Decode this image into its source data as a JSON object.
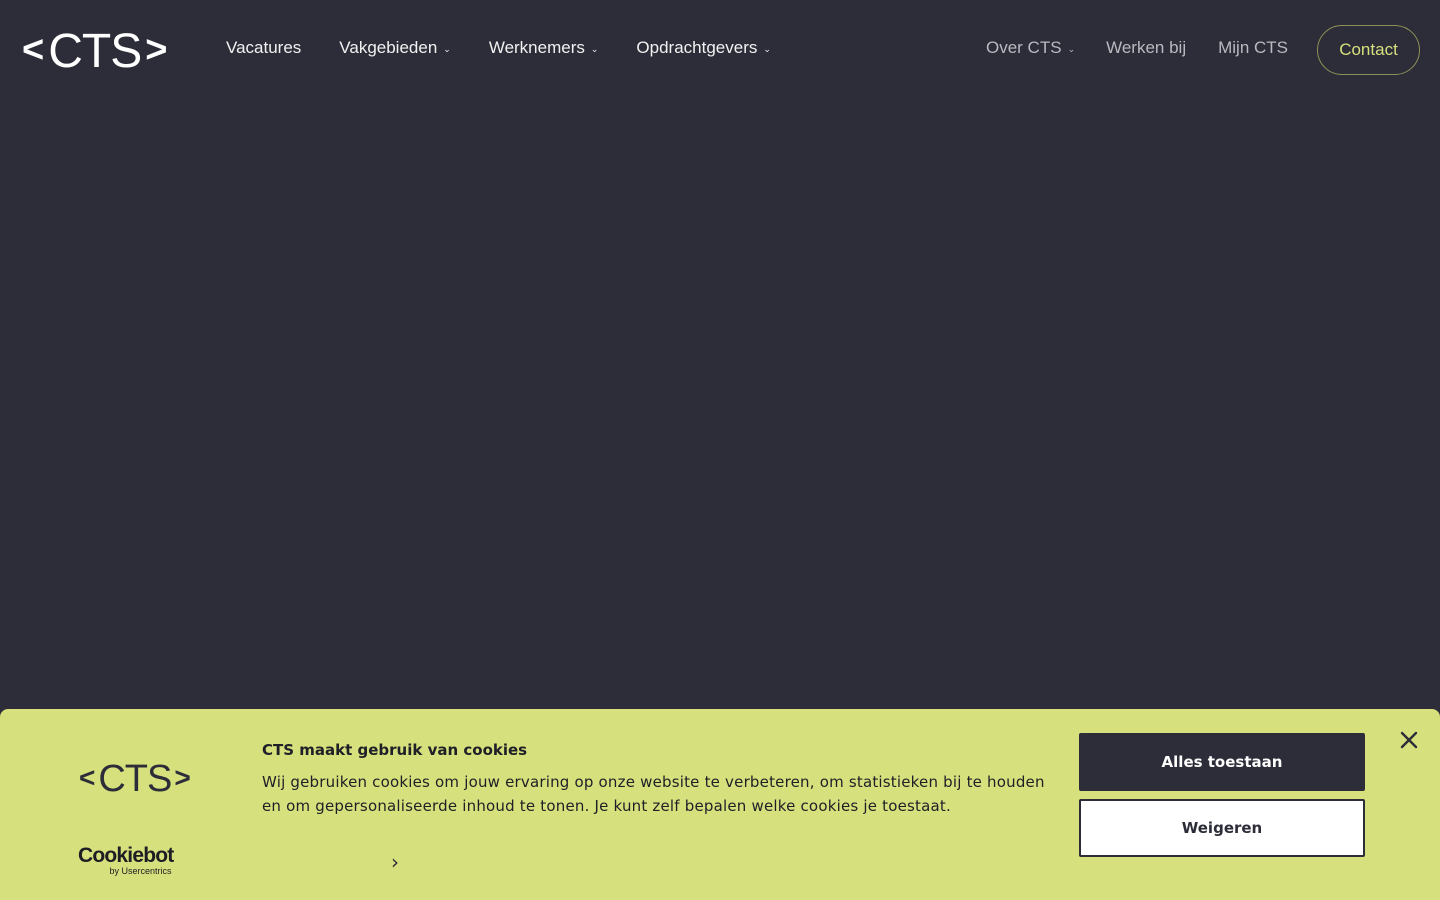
{
  "header": {
    "logo_left": "<",
    "logo_word": "CTS",
    "logo_right": ">",
    "nav_left": [
      {
        "label": "Vacatures",
        "dropdown": false
      },
      {
        "label": "Vakgebieden",
        "dropdown": true
      },
      {
        "label": "Werknemers",
        "dropdown": true
      },
      {
        "label": "Opdrachtgevers",
        "dropdown": true
      }
    ],
    "nav_right": [
      {
        "label": "Over CTS",
        "dropdown": true
      },
      {
        "label": "Werken bij",
        "dropdown": false
      },
      {
        "label": "Mijn CTS",
        "dropdown": false
      }
    ],
    "contact_label": "Contact",
    "caret_icon": "chevron-down-icon"
  },
  "cookie_banner": {
    "logo_left": "<",
    "logo_word": "CTS",
    "logo_right": ">",
    "title": "CTS maakt gebruik van cookies",
    "text": "Wij gebruiken cookies om jouw ervaring op onze website te verbeteren, om statistieken bij te houden en om gepersonaliseerde inhoud te tonen. Je kunt zelf bepalen welke cookies je toestaat.",
    "allow_label": "Alles toestaan",
    "deny_label": "Weigeren",
    "cookiebot_brand": "Cookiebot",
    "cookiebot_sub": "by Usercentrics",
    "details_icon": "chevron-right-icon",
    "close_icon": "close-icon"
  },
  "colors": {
    "background": "#2d2d39",
    "accent": "#d6e07c",
    "nav_text": "#f1f1f1",
    "nav_text_muted": "#b9b9c0"
  }
}
